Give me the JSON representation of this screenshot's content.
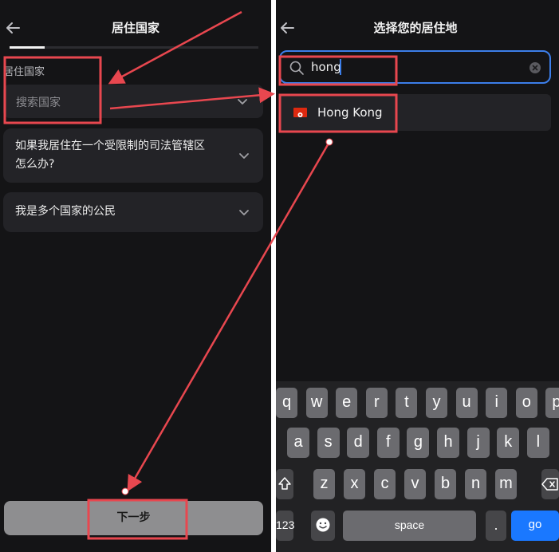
{
  "left": {
    "title": "居住国家",
    "progress_fraction": 0.14,
    "field_label": "居住国家",
    "field_placeholder": "搜索国家",
    "faq_items": [
      {
        "text": "如果我居住在一个受限制的司法管辖区怎么办?"
      },
      {
        "text": "我是多个国家的公民"
      }
    ],
    "next_label": "下一步"
  },
  "right": {
    "title": "选择您的居住地",
    "search_value": "hong",
    "result": {
      "name": "Hong Kong",
      "flag": "hong-kong-flag"
    }
  },
  "keyboard": {
    "row1": [
      "q",
      "w",
      "e",
      "r",
      "t",
      "y",
      "u",
      "i",
      "o",
      "p"
    ],
    "row2": [
      "a",
      "s",
      "d",
      "f",
      "g",
      "h",
      "j",
      "k",
      "l"
    ],
    "row3": [
      "z",
      "x",
      "c",
      "v",
      "b",
      "n",
      "m"
    ],
    "numbers_label": "123",
    "space_label": "space",
    "period_label": ".",
    "go_label": "go"
  },
  "colors": {
    "background": "#141416",
    "card": "#232327",
    "accent_blue": "#3c7ee9",
    "annotation_red": "#e8474f",
    "go_key": "#1a78ff"
  }
}
